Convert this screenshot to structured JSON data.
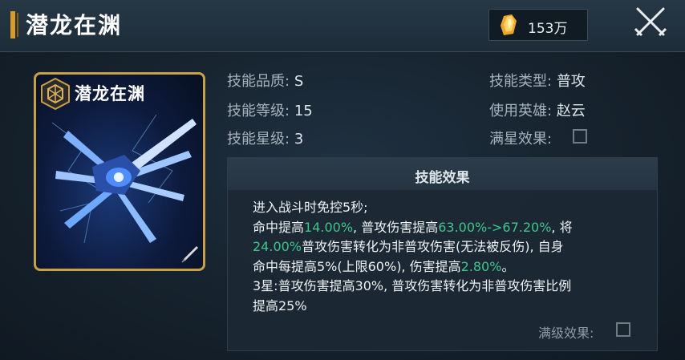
{
  "header": {
    "title": "潜龙在渊",
    "currency_icon": "crystal-icon",
    "currency_amount": "153万",
    "close_icon": "crossed-swords-close-icon"
  },
  "card": {
    "title": "潜龙在渊",
    "badge_icon": "hexagon-emblem-icon",
    "art": "blue-winged-blade-illustration",
    "corner_icon": "quill-icon",
    "frame_color": "#c9a04a"
  },
  "attributes": {
    "quality": {
      "label": "技能品质:",
      "value": "S"
    },
    "level": {
      "label": "技能等级:",
      "value": "15"
    },
    "star": {
      "label": "技能星级:",
      "value": "3"
    },
    "type": {
      "label": "技能类型:",
      "value": "普攻"
    },
    "hero": {
      "label": "使用英雄:",
      "value": "赵云"
    },
    "full_star": {
      "label": "满星效果:",
      "checked": false
    }
  },
  "effect_panel": {
    "title": "技能效果",
    "line1": "进入战斗时免控5秒;",
    "line2": {
      "a": "命中提高",
      "b": "14.00%",
      "c": ", 普攻伤害提高",
      "d": "63.00%->67.20%",
      "e": ", 将"
    },
    "line3": {
      "a": "24.00%",
      "b": "普攻伤害转化为非普攻伤害(无法被反伤), 自身"
    },
    "line4": {
      "a": "命中每提高5%(上限60%), 伤害提高",
      "b": "2.80%",
      "c": "。"
    },
    "line5": "3星:普攻伤害提高30%, 普攻伤害转化为非普攻伤害比例",
    "line6": "提高25%",
    "max_level": {
      "label": "满级效果:",
      "checked": false
    },
    "highlight_color": "#3fc48c"
  }
}
